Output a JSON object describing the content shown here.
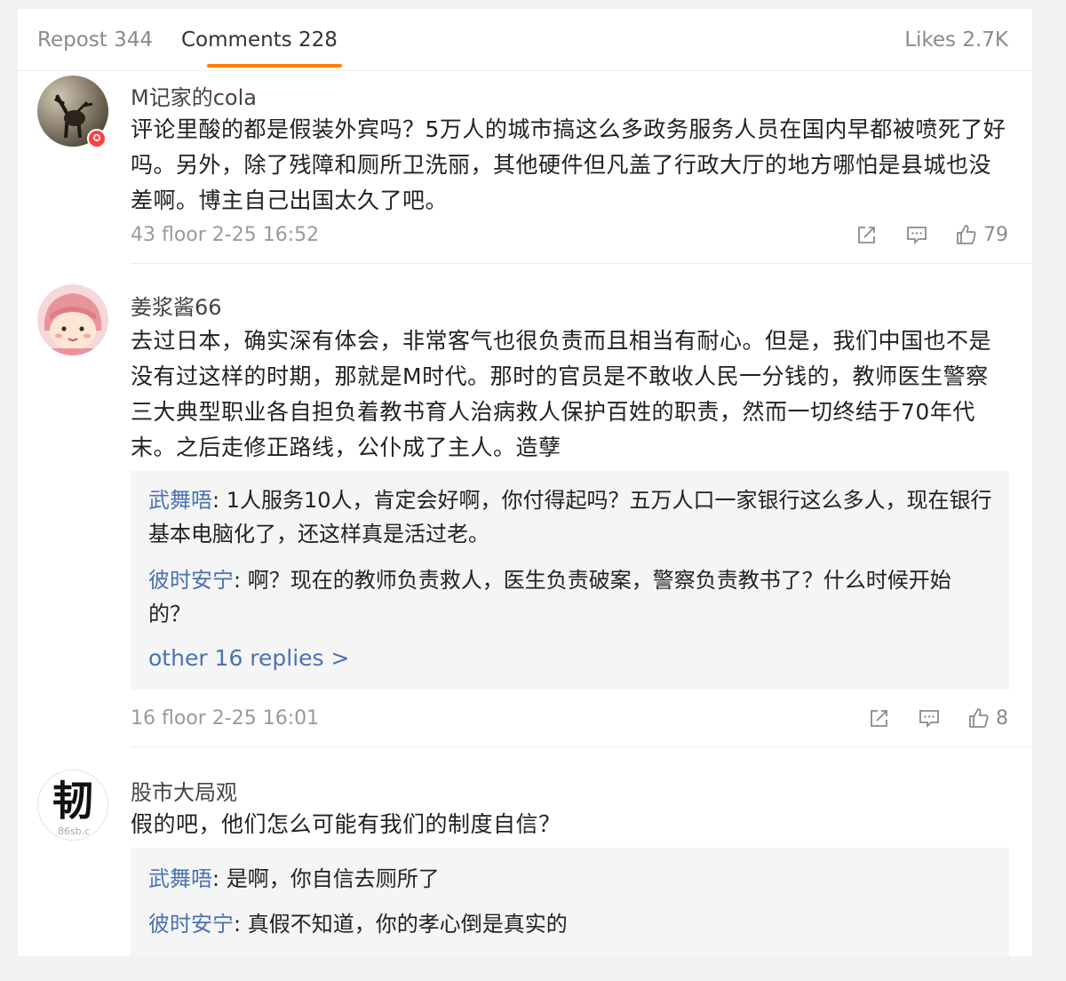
{
  "tabs": {
    "repost": "Repost 344",
    "comments": "Comments 228",
    "likes": "Likes 2.7K"
  },
  "colors": {
    "accent": "#ff8200",
    "link": "#4a72b2",
    "meta": "#9a9a9a"
  },
  "comments": [
    {
      "username": "M记家的cola",
      "text": "评论里酸的都是假装外宾吗？5万人的城市搞这么多政务服务人员在国内早都被喷死了好吗。另外，除了残障和厕所卫洗丽，其他硬件但凡盖了行政大厅的地方哪怕是县城也没差啊。博主自己出国太久了吧。",
      "meta": "43 floor 2-25 16:52",
      "likes": "79",
      "badge_icon": "verified-badge-icon"
    },
    {
      "username": "姜浆酱66",
      "text": "去过日本，确实深有体会，非常客气也很负责而且相当有耐心。但是，我们中国也不是没有过这样的时期，那就是M时代。那时的官员是不敢收人民一分钱的，教师医生警察三大典型职业各自担负着教书育人治病救人保护百姓的职责，然而一切终结于70年代末。之后走修正路线，公仆成了主人。造孽",
      "replies": [
        {
          "user": "武舞唔",
          "text": "1人服务10人，肯定会好啊，你付得起吗？五万人口一家银行这么多人，现在银行基本电脑化了，还这样真是活过老。"
        },
        {
          "user": "彼时安宁",
          "text": "啊？现在的教师负责救人，医生负责破案，警察负责教书了？什么时候开始的？"
        }
      ],
      "more_replies": "other 16 replies >",
      "meta": "16 floor 2-25 16:01",
      "likes": "8"
    },
    {
      "username": "股市大局观",
      "text": "假的吧，他们怎么可能有我们的制度自信？",
      "avatar_char": "韧",
      "avatar_watermark": "86sb.c",
      "replies": [
        {
          "user": "武舞唔",
          "text": "是啊，你自信去厕所了"
        },
        {
          "user": "彼时安宁",
          "text": "真假不知道，你的孝心倒是真实的"
        }
      ]
    }
  ],
  "separator": ": "
}
